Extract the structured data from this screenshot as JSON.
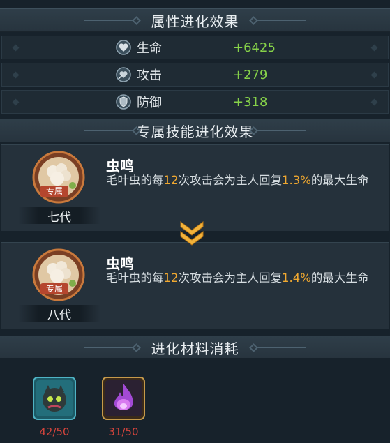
{
  "attr_section": {
    "title": "属性进化效果"
  },
  "stats": [
    {
      "icon": "heart-shield-icon",
      "name": "生命",
      "value": "+6425"
    },
    {
      "icon": "attack-heart-icon",
      "name": "攻击",
      "value": "+279"
    },
    {
      "icon": "shield-icon",
      "name": "防御",
      "value": "+318"
    }
  ],
  "skill_section": {
    "title": "专属技能进化效果"
  },
  "skills": [
    {
      "generation": "七代",
      "badge_label": "专属",
      "name": "虫鸣",
      "desc_prefix": "毛叶虫的每",
      "attack_count": "12",
      "desc_middle": "次攻击会为主人回复",
      "percent": "1.3%",
      "desc_suffix": "的最大生命"
    },
    {
      "generation": "八代",
      "badge_label": "专属",
      "name": "虫鸣",
      "desc_prefix": "毛叶虫的每",
      "attack_count": "12",
      "desc_middle": "次攻击会为主人回复",
      "percent": "1.4%",
      "desc_suffix": "的最大生命"
    }
  ],
  "material_section": {
    "title": "进化材料消耗"
  },
  "materials": [
    {
      "icon": "dark-creature-icon",
      "count": "42/50"
    },
    {
      "icon": "purple-flame-icon",
      "count": "31/50"
    }
  ],
  "colors": {
    "stat_value": "#86d249",
    "highlight": "#f0a830",
    "count_insufficient": "#d2443c",
    "chevron": "#f2b23a"
  }
}
